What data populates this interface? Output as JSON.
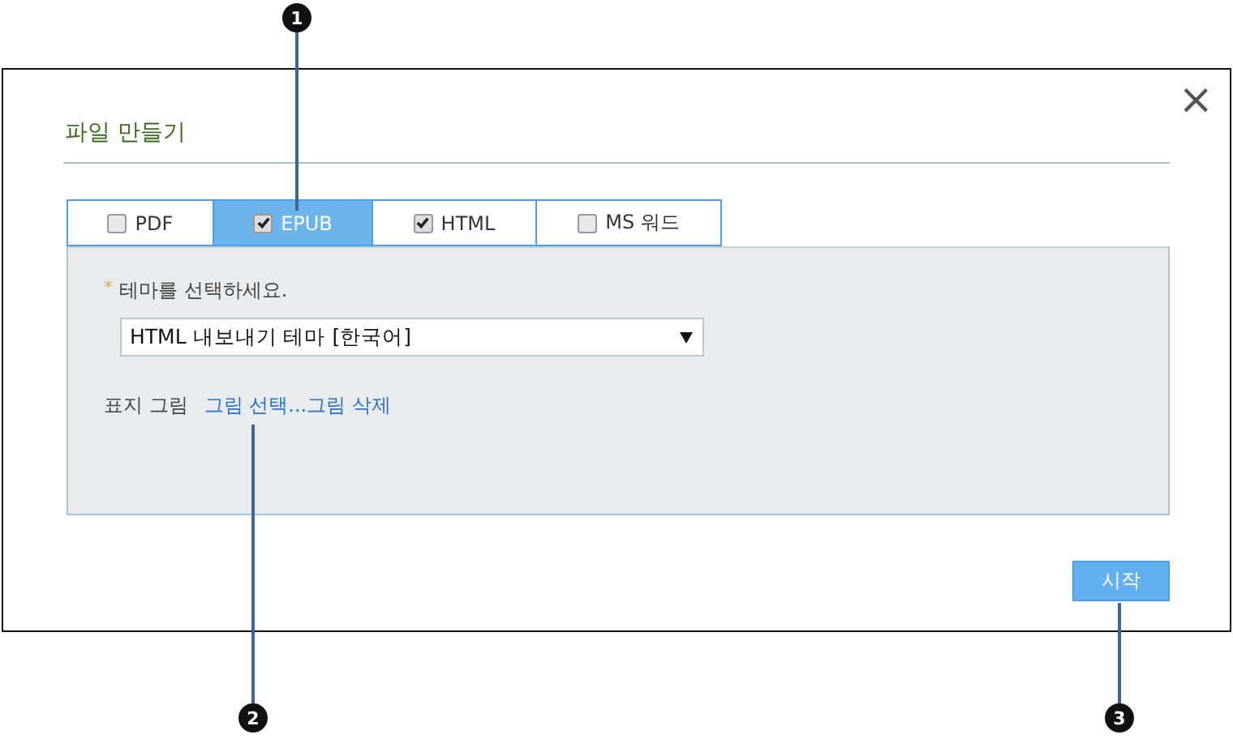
{
  "dialog": {
    "title": "파일 만들기",
    "close": "×"
  },
  "tabs": [
    {
      "label": "PDF",
      "checked": false,
      "selected": false
    },
    {
      "label": "EPUB",
      "checked": true,
      "selected": true
    },
    {
      "label": "HTML",
      "checked": true,
      "selected": false
    },
    {
      "label": "MS 워드",
      "checked": false,
      "selected": false
    }
  ],
  "theme": {
    "required_mark": "*",
    "label": "테마를 선택하세요.",
    "value": "HTML 내보내기 테마 [한국어]"
  },
  "cover": {
    "label": "표지 그림",
    "links": [
      "그림 선택...",
      "그림 삭제"
    ]
  },
  "start_button": "시작",
  "callouts": [
    {
      "label": "1"
    },
    {
      "label": "2"
    },
    {
      "label": "3"
    }
  ]
}
